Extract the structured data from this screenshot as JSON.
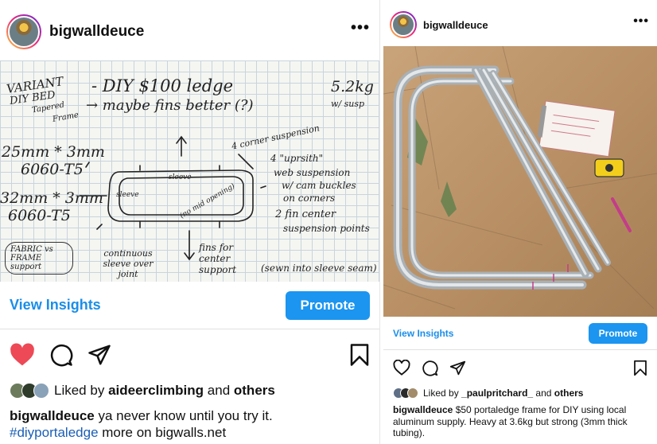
{
  "left_post": {
    "username": "bigwalldeuce",
    "more_label": "•••",
    "sketch": {
      "variant": "VARIANT",
      "diy_bed": "DIY BED",
      "tapered": "Tapered",
      "frame": "Frame",
      "title": "- DIY $100 ledge",
      "maybe_fins": "→ maybe fins better (?)",
      "weight": "5.2kg",
      "weight_note": "w/ susp",
      "tube1_a": "25mm * 3mm",
      "tube1_b": "6060-T5",
      "tube2_a": "32mm * 3mm",
      "tube2_b": "6060-T5",
      "corner_suspension": "4 corner suspension",
      "uprsith": "4 \"uprsith\"",
      "web_suspension": "web suspension",
      "cam_buckles": "w/ cam buckles",
      "on_corners": "on corners",
      "fin_center": "2 fin center",
      "suspension_points": "suspension points",
      "fabric_vs_frame": "FABRIC vs FRAME support",
      "continuous_sleeve": "continuous sleeve over joint",
      "fins_for_center": "fins for center support",
      "sewn_into": "(sewn into sleeve seam)",
      "sleeve": "sleeve",
      "no_mid": "(no mid opening)"
    },
    "view_insights": "View Insights",
    "promote": "Promote",
    "liked_by_prefix": "Liked by",
    "liked_by_user": "aideerclimbing",
    "liked_by_and": "and",
    "liked_by_others": "others",
    "caption_user": "bigwalldeuce",
    "caption_text": "ya never know until you try it.",
    "caption_hashtag": "#diyportaledge",
    "caption_rest": "more on bigwalls.net"
  },
  "right_post": {
    "username": "bigwalldeuce",
    "more_label": "•••",
    "view_insights": "View Insights",
    "promote": "Promote",
    "liked_by_prefix": "Liked by",
    "liked_by_user": "_paulpritchard_",
    "liked_by_and": "and",
    "liked_by_others": "others",
    "caption_user": "bigwalldeuce",
    "caption_text": "$50 portaledge frame for DIY using local aluminum supply. Heavy at 3.6kg but strong (3mm thick tubing)."
  },
  "colors": {
    "accent": "#1b95f0",
    "like_red": "#ed4956",
    "hashtag": "#1b5fb5"
  },
  "icons": [
    "heart-icon",
    "comment-icon",
    "share-icon",
    "bookmark-icon",
    "more-icon"
  ]
}
